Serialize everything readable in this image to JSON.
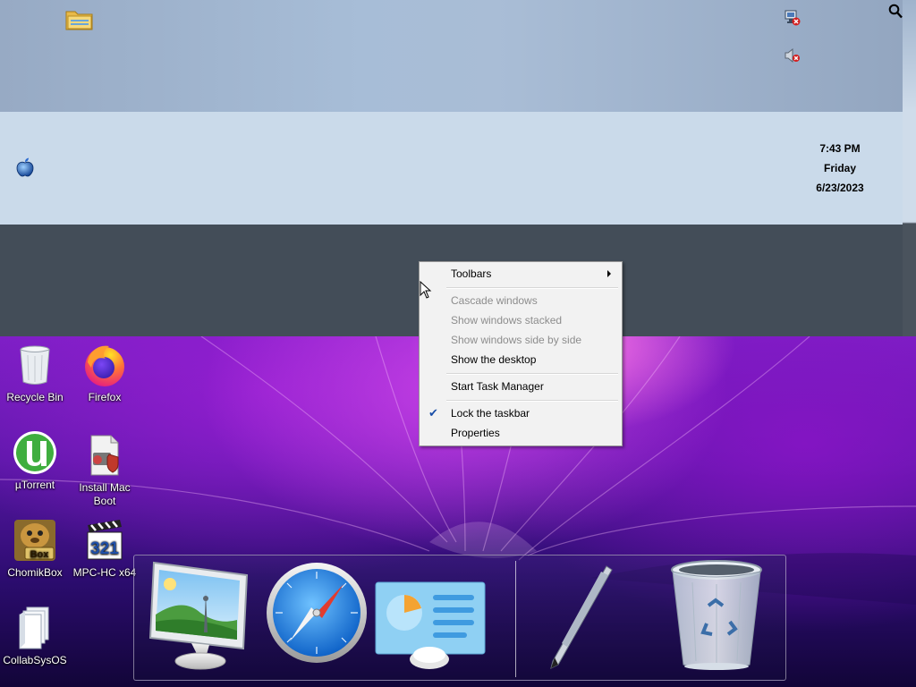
{
  "taskbar": {
    "clock": {
      "time": "7:43 PM",
      "day": "Friday",
      "date": "6/23/2023"
    },
    "icons": [
      "file-explorer-icon",
      "apple-start-icon",
      "network-error-icon",
      "volume-muted-icon",
      "search-icon"
    ]
  },
  "context_menu": {
    "items": [
      {
        "label": "Toolbars",
        "enabled": true,
        "submenu": true
      },
      {
        "label": "Cascade windows",
        "enabled": false
      },
      {
        "label": "Show windows stacked",
        "enabled": false
      },
      {
        "label": "Show windows side by side",
        "enabled": false
      },
      {
        "label": "Show the desktop",
        "enabled": true
      },
      {
        "label": "Start Task Manager",
        "enabled": true
      },
      {
        "label": "Lock the taskbar",
        "enabled": true,
        "checked": true
      },
      {
        "label": "Properties",
        "enabled": true
      }
    ]
  },
  "desktop_icons": [
    {
      "label": "Recycle Bin",
      "icon": "recycle-bin-icon"
    },
    {
      "label": "Firefox",
      "icon": "firefox-icon"
    },
    {
      "label": "µTorrent",
      "icon": "utorrent-icon"
    },
    {
      "label": "Install Mac Boot",
      "icon": "install-mac-boot-icon"
    },
    {
      "label": "ChomikBox",
      "icon": "chomikbox-icon"
    },
    {
      "label": "MPC-HC x64",
      "icon": "mpc-hc-icon"
    },
    {
      "label": "CollabSysOS",
      "icon": "collabsysos-icon"
    }
  ],
  "dock": {
    "items": [
      "desktop-photo-icon",
      "safari-compass-icon",
      "control-panel-icon",
      "pen-icon",
      "trash-bin-icon"
    ]
  }
}
